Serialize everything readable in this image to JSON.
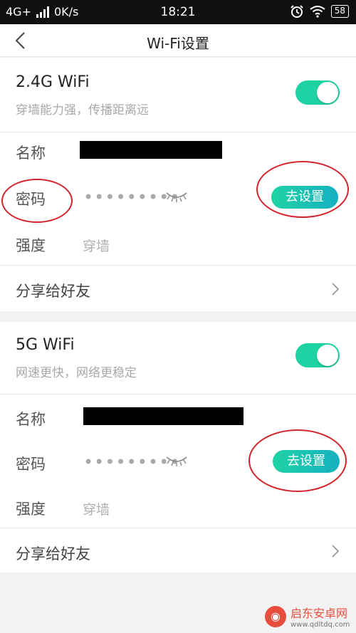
{
  "status_bar": {
    "network": "4G+",
    "speed": "0K/s",
    "time": "18:21",
    "battery": "58"
  },
  "header": {
    "title": "Wi-Fi设置"
  },
  "wifi_24": {
    "name": "2.4G WiFi",
    "description": "穿墙能力强，传播距离远",
    "enabled": true,
    "name_label": "名称",
    "password_label": "密码",
    "password_mask": "•••••••••",
    "set_button_label": "去设置",
    "strength_label": "强度",
    "strength_value": "穿墙",
    "share_label": "分享给好友"
  },
  "wifi_5": {
    "name": "5G WiFi",
    "description": "网速更快，网络更稳定",
    "enabled": true,
    "name_label": "名称",
    "password_label": "密码",
    "password_mask": "•••••••••",
    "set_button_label": "去设置",
    "strength_label": "强度",
    "strength_value": "穿墙",
    "share_label": "分享给好友"
  },
  "watermark": {
    "text": "启东安卓网",
    "url": "www.qdltdq.com"
  },
  "colors": {
    "accent": "#1ed2a3",
    "annotation": "#d4232a",
    "background": "#f2f2f2"
  }
}
